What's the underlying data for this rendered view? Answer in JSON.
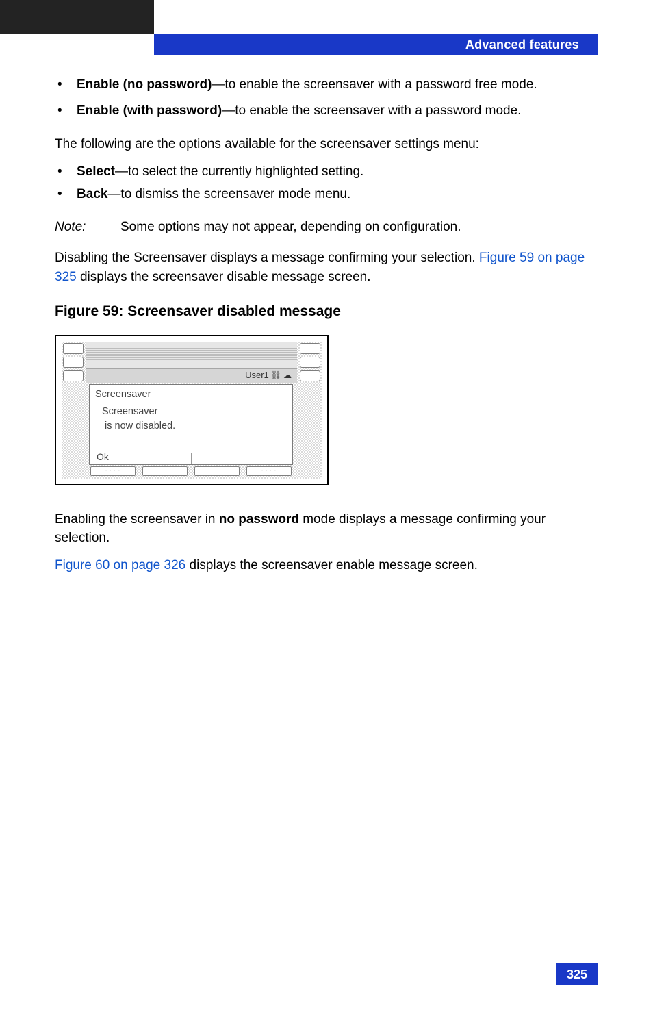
{
  "header": {
    "title": "Advanced features"
  },
  "bullets1": [
    {
      "bold": "Enable (no password)",
      "desc": "—to enable the screensaver with a password free mode."
    },
    {
      "bold": "Enable (with password)",
      "desc": "—to enable the screensaver with a password mode."
    }
  ],
  "options_intro": "The following are the options available for the screensaver settings menu:",
  "bullets2": [
    {
      "bold": "Select",
      "desc": "—to select the currently highlighted setting."
    },
    {
      "bold": "Back",
      "desc": "—to dismiss the screensaver mode menu."
    }
  ],
  "note": {
    "label": "Note:",
    "text": "Some options may not appear, depending on configuration."
  },
  "para_disable": {
    "pre": "Disabling the Screensaver displays a message confirming your selection. ",
    "link": "Figure 59 on page 325",
    "post": " displays the screensaver disable message screen."
  },
  "figure": {
    "caption": "Figure 59: Screensaver disabled message",
    "user": "User1",
    "title": "Screensaver",
    "line1": "Screensaver",
    "line2": "is now disabled.",
    "ok": "Ok"
  },
  "para_enable": {
    "pre": "Enabling the screensaver in ",
    "bold": "no password",
    "post": " mode displays a message confirming your selection."
  },
  "link60": {
    "link": "Figure 60 on page 326",
    "post": " displays the screensaver enable message screen."
  },
  "page": "325"
}
